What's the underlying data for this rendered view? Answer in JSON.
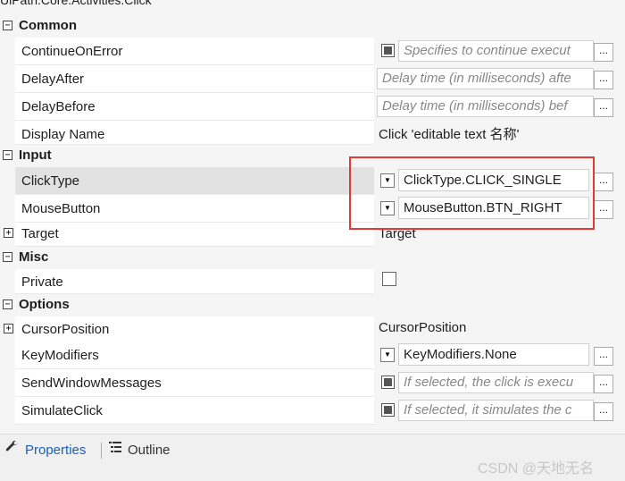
{
  "header": {
    "title": "UiPath.Core.Activities.Click"
  },
  "categories": {
    "common": "Common",
    "input": "Input",
    "misc": "Misc",
    "options": "Options"
  },
  "properties": {
    "continue_on_error": {
      "name": "ContinueOnError",
      "hint": "Specifies to continue execut"
    },
    "delay_after": {
      "name": "DelayAfter",
      "hint": "Delay time (in milliseconds) afte"
    },
    "delay_before": {
      "name": "DelayBefore",
      "hint": "Delay time (in milliseconds) bef"
    },
    "display_name": {
      "name": "Display Name",
      "value": "Click 'editable text  名称'"
    },
    "click_type": {
      "name": "ClickType",
      "value": "ClickType.CLICK_SINGLE"
    },
    "mouse_button": {
      "name": "MouseButton",
      "value": "MouseButton.BTN_RIGHT"
    },
    "target": {
      "name": "Target",
      "value": "Target"
    },
    "private": {
      "name": "Private"
    },
    "cursor_position": {
      "name": "CursorPosition",
      "value": "CursorPosition"
    },
    "key_modifiers": {
      "name": "KeyModifiers",
      "value": "KeyModifiers.None"
    },
    "send_window_messages": {
      "name": "SendWindowMessages",
      "hint": "If selected, the click is execu"
    },
    "simulate_click": {
      "name": "SimulateClick",
      "hint": "If selected, it simulates the c"
    }
  },
  "ellipsis": "...",
  "tabs": {
    "properties": "Properties",
    "outline": "Outline"
  },
  "watermark": "CSDN @天地无名",
  "icons": [
    "collapse-icon",
    "expand-icon",
    "dropdown-arrow-icon",
    "checkbox-icon",
    "wrench-icon",
    "outline-icon"
  ],
  "colors": {
    "highlight": "#e53935",
    "active_tab": "#1a5fb4",
    "selected_row": "#e2e2e2"
  }
}
